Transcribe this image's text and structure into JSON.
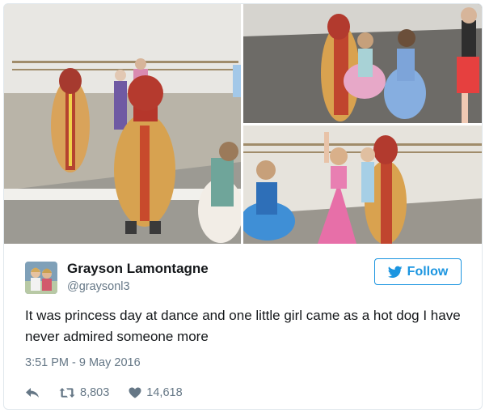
{
  "tweet": {
    "display_name": "Grayson Lamontagne",
    "handle": "@graysonl3",
    "follow_label": "Follow",
    "text": "It was princess day at dance and one little girl came as a hot dog I have never admired someone more",
    "timestamp": "3:51 PM - 9 May 2016",
    "retweets": "8,803",
    "likes": "14,618"
  },
  "media": {
    "photos": [
      "dance-studio-mirror-photo",
      "dance-circle-photo",
      "dance-twirl-photo"
    ]
  },
  "colors": {
    "accent": "#1b95e0",
    "secondary_text": "#657786",
    "border": "#e1e8ed"
  },
  "icons": [
    "twitter-bird-icon",
    "reply-icon",
    "retweet-icon",
    "heart-icon"
  ]
}
